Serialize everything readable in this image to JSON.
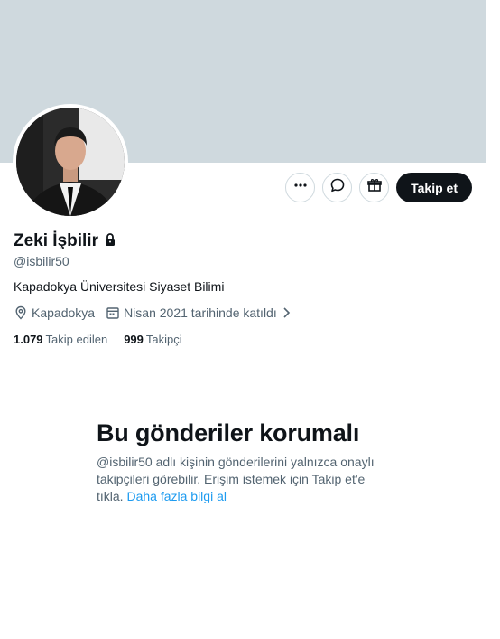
{
  "profile": {
    "display_name": "Zeki İşbilir",
    "handle": "@isbilir50",
    "bio": "Kapadokya Üniversitesi Siyaset Bilimi",
    "location": "Kapadokya",
    "joined": "Nisan 2021 tarihinde katıldı",
    "following_count": "1.079",
    "following_label": "Takip edilen",
    "followers_count": "999",
    "followers_label": "Takipçi"
  },
  "actions": {
    "more_icon": "more-horizontal-icon",
    "message_icon": "message-bubble-icon",
    "gift_icon": "gift-icon",
    "follow_label": "Takip et"
  },
  "protected": {
    "title": "Bu gönderiler korumalı",
    "text": "@isbilir50 adlı kişinin gönderilerini yalnızca onaylı takipçileri görebilir. Erişim istemek için Takip et'e tıkla.",
    "link": "Daha fazla bilgi al"
  },
  "colors": {
    "banner": "#cfd9de",
    "accent": "#1d9bf0",
    "text_primary": "#0f1419",
    "text_secondary": "#536471",
    "follow_button": "#0f1419"
  }
}
